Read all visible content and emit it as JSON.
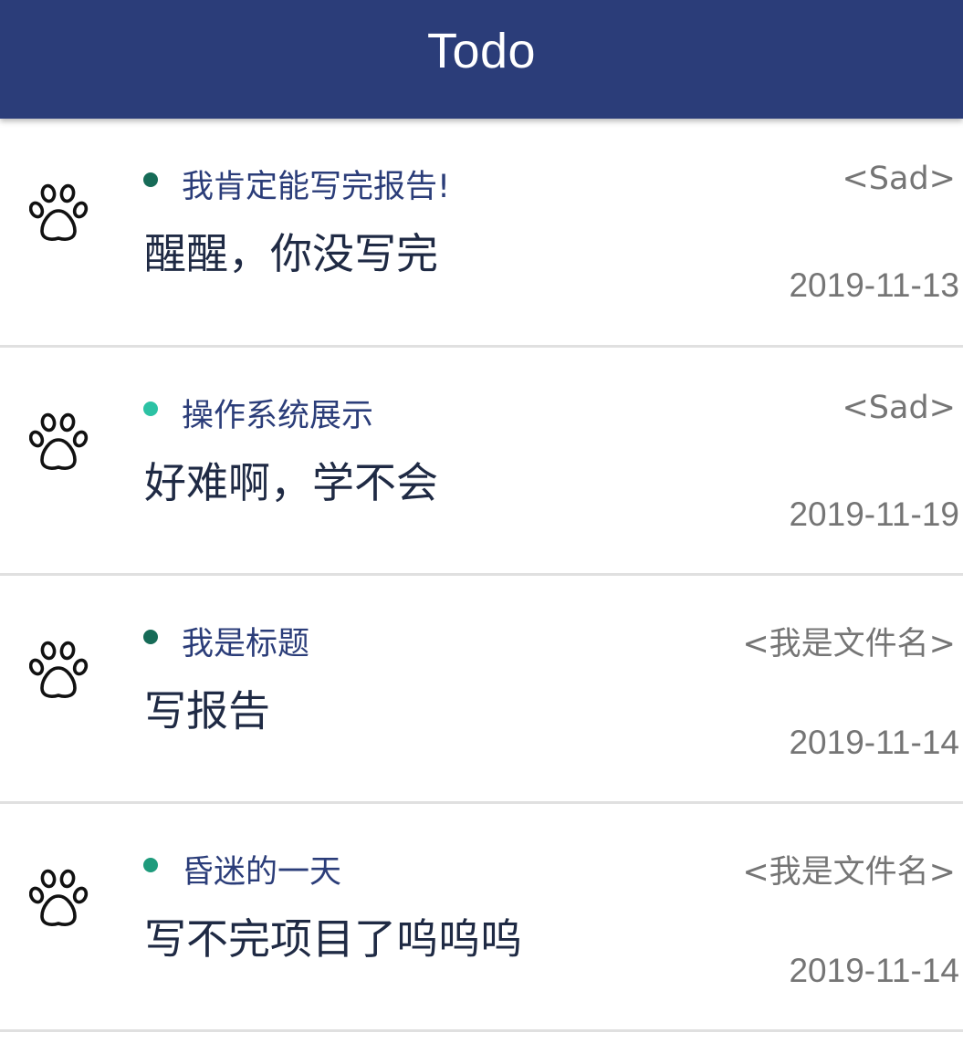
{
  "appbar": {
    "title": "Todo",
    "background_color": "#2b3d79"
  },
  "items": [
    {
      "title": "我肯定能写完报告!",
      "tag": "<Sad>",
      "content": "醒醒，你没写完",
      "date": "2019-11-13",
      "dot_color": "#166b57",
      "icon": "paw-icon"
    },
    {
      "title": "操作系统展示",
      "tag": "<Sad>",
      "content": "好难啊，学不会",
      "date": "2019-11-19",
      "dot_color": "#2cc2a4",
      "icon": "paw-icon"
    },
    {
      "title": "我是标题",
      "tag": "<我是文件名>",
      "content": "写报告",
      "date": "2019-11-14",
      "dot_color": "#166b57",
      "icon": "paw-icon"
    },
    {
      "title": "昏迷的一天",
      "tag": "<我是文件名>",
      "content": "写不完项目了呜呜呜",
      "date": "2019-11-14",
      "dot_color": "#1e9b7c",
      "icon": "paw-icon"
    }
  ]
}
